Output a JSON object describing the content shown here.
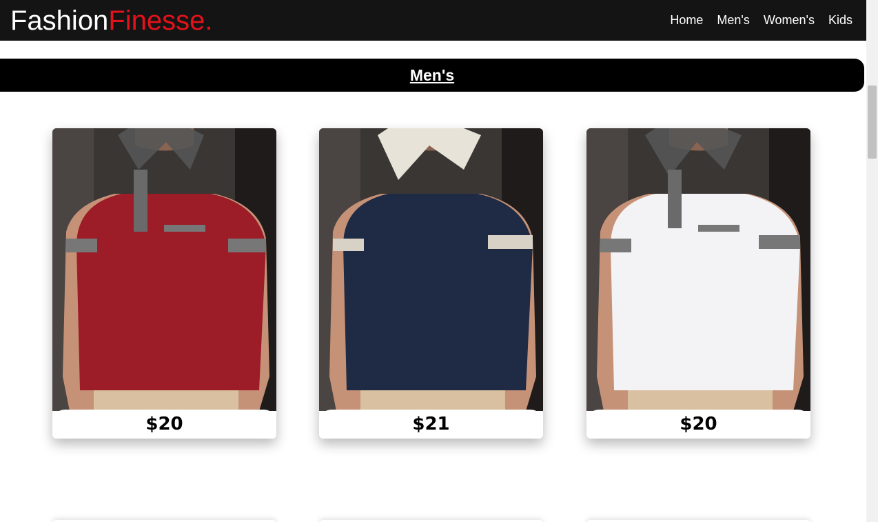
{
  "brand": {
    "name_part1": "Fashion",
    "name_part2": "Finesse."
  },
  "nav": {
    "items": [
      {
        "label": "Home"
      },
      {
        "label": "Men's"
      },
      {
        "label": "Women's"
      },
      {
        "label": "Kids"
      }
    ]
  },
  "section": {
    "title": "Men's"
  },
  "products": [
    {
      "price": "$20",
      "shirt_color": "#9c1c28",
      "collar": "houndstooth"
    },
    {
      "price": "$21",
      "shirt_color": "#1f2a44",
      "collar": "striped"
    },
    {
      "price": "$20",
      "shirt_color": "#f3f3f5",
      "collar": "houndstooth"
    }
  ],
  "colors": {
    "navbar": "#141414",
    "accent": "#e3121b",
    "banner": "#000000"
  }
}
